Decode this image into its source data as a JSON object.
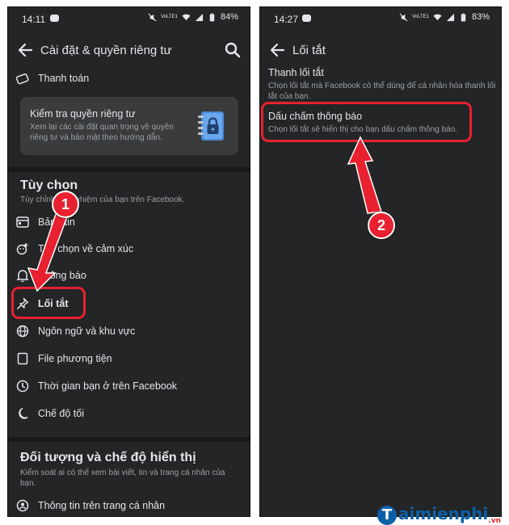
{
  "left": {
    "status": {
      "time": "14:11",
      "battery": "84%",
      "net": "VoLTE1"
    },
    "header": {
      "title": "Cài đặt & quyền riêng tư"
    },
    "payment": {
      "label": "Thanh toán"
    },
    "privacy_card": {
      "title": "Kiểm tra quyền riêng tư",
      "desc": "Xem lại các cài đặt quan trọng về quyền riêng tư và bảo mật theo hướng dẫn."
    },
    "options": {
      "title": "Tùy chọn",
      "subtitle": "Tùy chỉnh trải nghiệm của bạn trên Facebook.",
      "items": [
        {
          "label": "Bảng tin"
        },
        {
          "label": "Tùy chọn về cảm xúc"
        },
        {
          "label": "Thông báo"
        },
        {
          "label": "Lối tắt"
        },
        {
          "label": "Ngôn ngữ và khu vực"
        },
        {
          "label": "File phương tiện"
        },
        {
          "label": "Thời gian bạn ở trên Facebook"
        },
        {
          "label": "Chế độ tối"
        }
      ]
    },
    "audience": {
      "title": "Đối tượng và chế độ hiển thị",
      "subtitle": "Kiểm soát ai có thể xem bài viết, tin và trang cá nhân của bạn.",
      "items": [
        {
          "label": "Thông tin trên trang cá nhân"
        }
      ]
    },
    "badge": "1"
  },
  "right": {
    "status": {
      "time": "14:27",
      "battery": "83%",
      "net": "VoLTE1"
    },
    "header": {
      "title": "Lối tắt"
    },
    "shortcut_bar": {
      "title": "Thanh lối tắt",
      "desc": "Chọn lối tắt mà Facebook có thể dùng để cá nhân hóa thanh lối tắt của bạn."
    },
    "notification_dots": {
      "title": "Dấu chấm thông báo",
      "desc": "Chọn lối tắt sẽ hiển thị cho bạn dấu chấm thông báo."
    },
    "badge": "2"
  },
  "watermark": {
    "text": "aimienphi",
    "initial": "T",
    "suffix": ".vn"
  },
  "colors": {
    "panel": "#242526",
    "card": "#3a3b3c",
    "accent_red": "#e8202f",
    "text": "#e4e6eb",
    "muted": "#9aa0a6"
  }
}
